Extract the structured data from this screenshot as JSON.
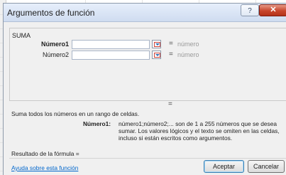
{
  "window": {
    "title": "Argumentos de función",
    "help_label": "?",
    "close_label": "✕"
  },
  "function": {
    "name": "SUMA"
  },
  "args": [
    {
      "label": "Número1",
      "value": "",
      "eq": "=",
      "result": "número"
    },
    {
      "label": "Número2",
      "value": "",
      "eq": "=",
      "result": "número"
    }
  ],
  "result_eq": "=",
  "description": "Suma todos los números en un rango de celdas.",
  "arg_description": {
    "label": "Número1:",
    "text": "número1;número2;... son de 1 a 255 números que se desea sumar. Los valores lógicos y el texto se omiten en las celdas, incluso si están escritos como argumentos."
  },
  "formula_result": "Resultado de la fórmula =",
  "help_link": "Ayuda sobre esta función",
  "buttons": {
    "ok": "Aceptar",
    "cancel": "Cancelar"
  }
}
